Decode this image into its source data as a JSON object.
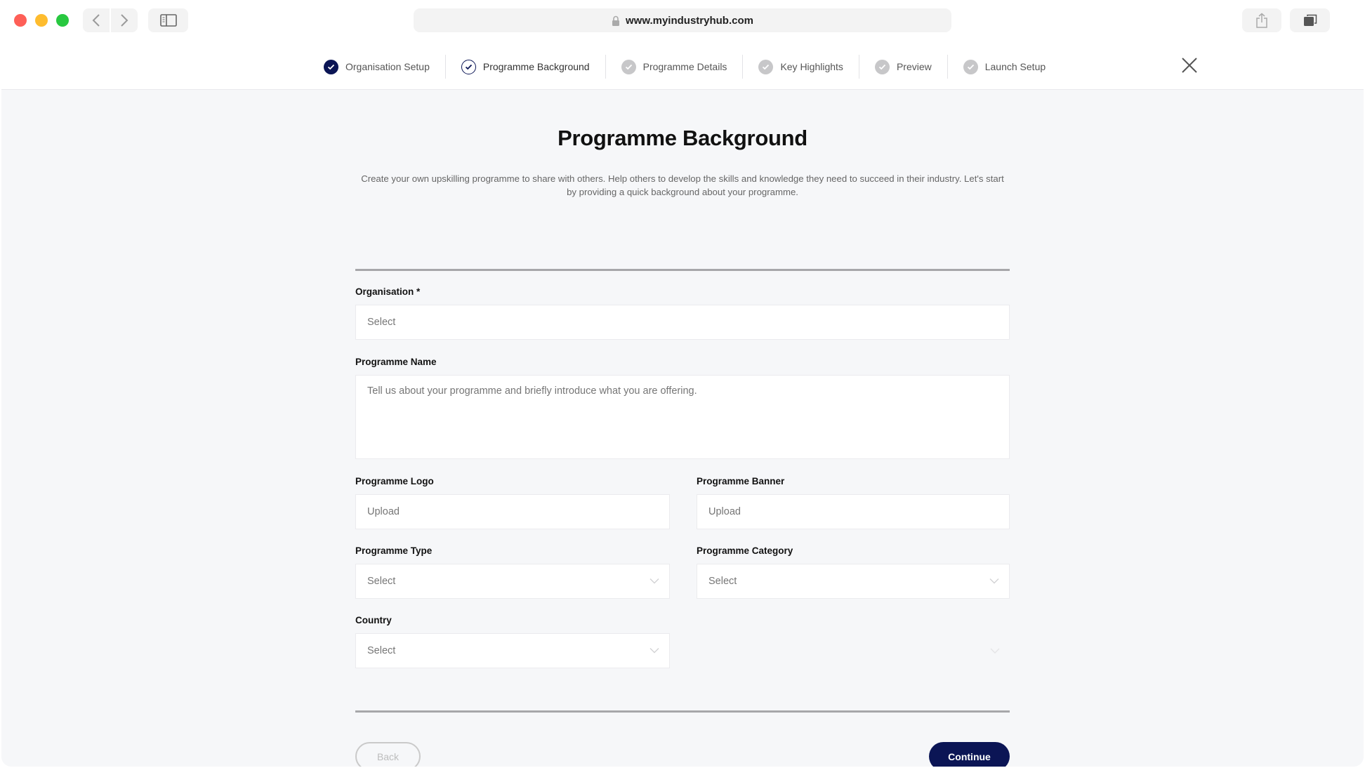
{
  "browser": {
    "url": "www.myindustryhub.com",
    "icons": {
      "back": "chevron-left-icon",
      "forward": "chevron-right-icon",
      "sidebar": "sidebar-icon",
      "lock": "lock-icon",
      "share": "share-icon",
      "tabs": "tabs-icon"
    }
  },
  "stepper": {
    "steps": [
      {
        "label": "Organisation Setup",
        "state": "done"
      },
      {
        "label": "Programme Background",
        "state": "current"
      },
      {
        "label": "Programme Details",
        "state": "pending"
      },
      {
        "label": "Key Highlights",
        "state": "pending"
      },
      {
        "label": "Preview",
        "state": "pending"
      },
      {
        "label": "Launch Setup",
        "state": "pending"
      }
    ],
    "close_icon": "close-icon"
  },
  "main": {
    "title": "Programme Background",
    "intro": "Create your own upskilling programme to share with others. Help others to develop the skills and knowledge they need to succeed in their industry. Let's start by providing a quick background about your programme."
  },
  "form": {
    "organisation": {
      "label": "Organisation *",
      "placeholder": "Select"
    },
    "programme_name": {
      "label": "Programme Name",
      "placeholder": "Tell us about your programme and briefly introduce what you are offering."
    },
    "programme_logo": {
      "label": "Programme Logo",
      "placeholder": "Upload"
    },
    "programme_banner": {
      "label": "Programme Banner",
      "placeholder": "Upload"
    },
    "programme_type": {
      "label": "Programme Type",
      "placeholder": "Select"
    },
    "programme_category": {
      "label": "Programme Category",
      "placeholder": "Select"
    },
    "country": {
      "label": "Country",
      "placeholder": "Select"
    }
  },
  "actions": {
    "back_label": "Back",
    "continue_label": "Continue"
  },
  "colors": {
    "primary": "#0b1555",
    "pending_step": "#c7c7c9",
    "page_bg": "#f6f7f9"
  }
}
